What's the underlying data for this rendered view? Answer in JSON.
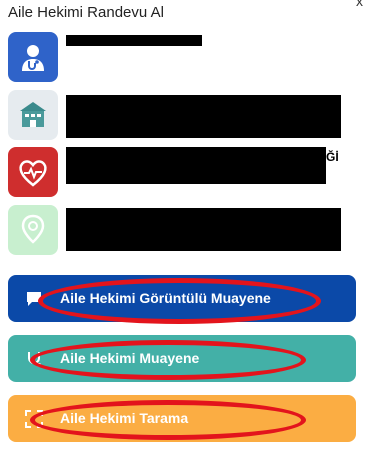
{
  "header": {
    "title": "Aile Hekimi Randevu Al",
    "close_glyph": "x"
  },
  "list": {
    "items": [
      {
        "icon": "doctor-icon",
        "color": "#2f63c9",
        "suffix": ""
      },
      {
        "icon": "hospital-icon",
        "color": "#e6ebef",
        "suffix": ""
      },
      {
        "icon": "heart-pulse-icon",
        "color": "#cf2e2e",
        "suffix": "Ğİ"
      },
      {
        "icon": "location-pin-icon",
        "color": "#c8efcf",
        "suffix": ""
      }
    ]
  },
  "buttons": [
    {
      "label": "Aile Hekimi Görüntülü Muayene",
      "color": "#0b49a8",
      "icon": "video-chat-icon"
    },
    {
      "label": "Aile Hekimi Muayene",
      "color": "#43b0a7",
      "icon": "stethoscope-icon"
    },
    {
      "label": "Aile Hekimi Tarama",
      "color": "#fbad43",
      "icon": "scan-icon"
    }
  ],
  "annotation": {
    "color": "#e3141c"
  }
}
